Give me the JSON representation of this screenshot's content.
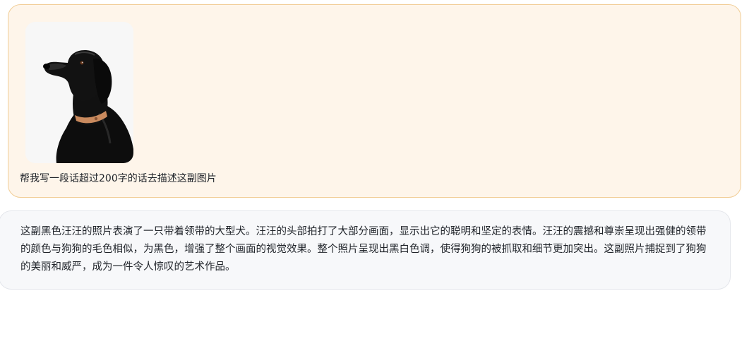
{
  "user_message": {
    "image_subject": "black-labrador-photo",
    "text": "帮我写一段话超过200字的话去描述这副图片"
  },
  "assistant_message": {
    "text": "这副黑色汪汪的照片表演了一只带着领带的大型犬。汪汪的头部拍打了大部分画面，显示出它的聪明和坚定的表情。汪汪的震撼和尊崇呈现出强健的领带的颜色与狗狗的毛色相似，为黑色，增强了整个画面的视觉效果。整个照片呈现出黑白色调，使得狗狗的被抓取和细节更加突出。这副照片捕捉到了狗狗的美丽和威严，成为一件令人惊叹的艺术作品。"
  },
  "colors": {
    "user_bubble_bg": "#fef5ea",
    "user_bubble_border": "#f1cd96",
    "assistant_bubble_bg": "#f7f8fa",
    "assistant_bubble_border": "#e4e6eb",
    "collar": "#c98a5e"
  }
}
